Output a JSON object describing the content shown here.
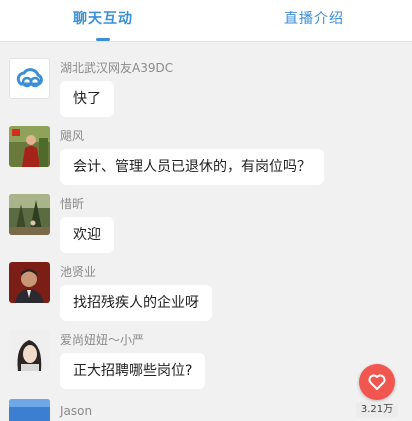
{
  "tabs": {
    "chat": "聊天互动",
    "intro": "直播介绍"
  },
  "messages": [
    {
      "user": "湖北武汉网友A39DC",
      "text": "快了",
      "avatar_icon": "cloud-logo-icon"
    },
    {
      "user": "飓风",
      "text": "会计、管理人员已退休的，有岗位吗？",
      "avatar_icon": "person-photo"
    },
    {
      "user": "惜昕",
      "text": "欢迎",
      "avatar_icon": "forest-photo"
    },
    {
      "user": "池贤业",
      "text": "找招残疾人的企业呀",
      "avatar_icon": "portrait-photo"
    },
    {
      "user": "爱尚妞妞～小严",
      "text": "正大招聘哪些岗位?",
      "avatar_icon": "woman-photo"
    },
    {
      "user": "Jason",
      "text": "",
      "avatar_icon": "sky-photo"
    }
  ],
  "like": {
    "icon": "heart-icon",
    "count": "3.21万"
  },
  "colors": {
    "accent": "#3b8fd9",
    "background": "#f1f1f2",
    "like": "#f2574f"
  }
}
